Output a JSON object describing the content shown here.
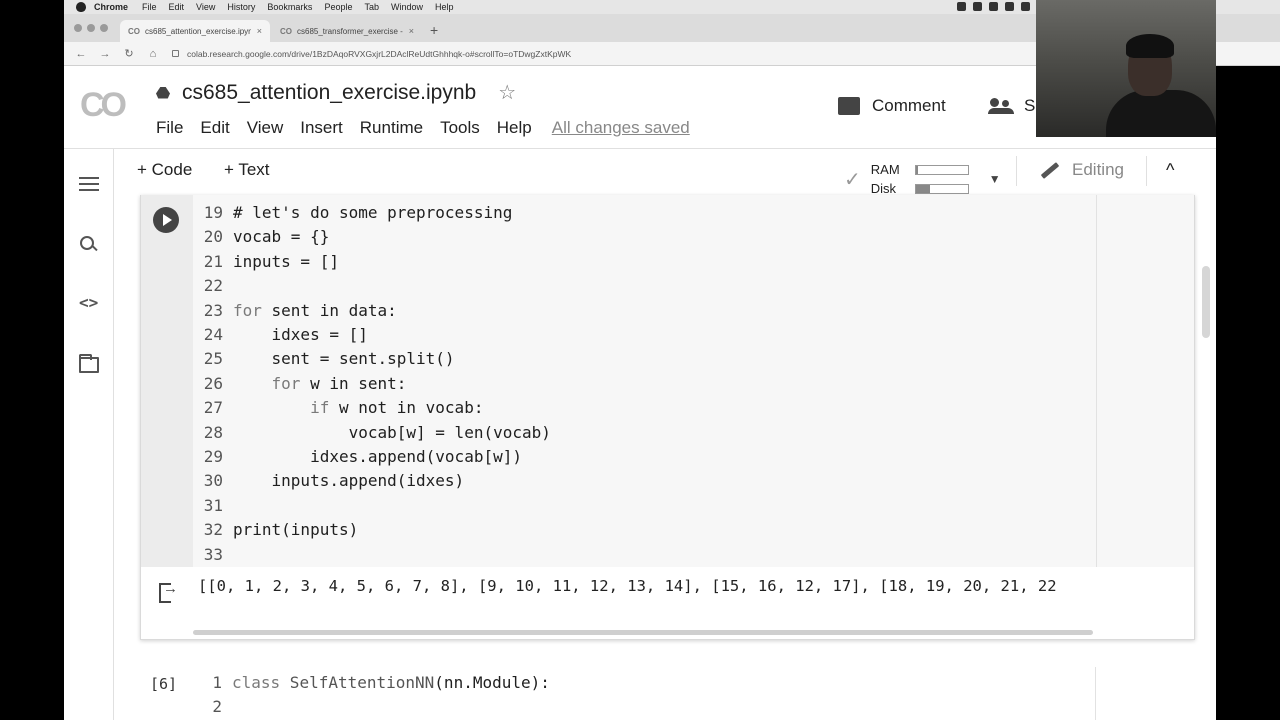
{
  "macos": {
    "app_name": "Chrome",
    "menu": [
      "File",
      "Edit",
      "View",
      "History",
      "Bookmarks",
      "People",
      "Tab",
      "Window",
      "Help"
    ]
  },
  "browser": {
    "tabs": [
      {
        "title": "cs685_attention_exercise.ipyn",
        "favicon": "CO",
        "active": true
      },
      {
        "title": "cs685_transformer_exercise -",
        "favicon": "CO",
        "active": false
      }
    ],
    "new_tab": "+",
    "url": "colab.research.google.com/drive/1BzDAqoRVXGxjrL2DAclReUdtGhhhqk-o#scrollTo=oTDwgZxtKpWK"
  },
  "colab": {
    "logo": "CO",
    "notebook_title": "cs685_attention_exercise.ipynb",
    "menu": [
      "File",
      "Edit",
      "View",
      "Insert",
      "Runtime",
      "Tools",
      "Help"
    ],
    "save_status": "All changes saved",
    "comment_label": "Comment",
    "share_label": "S",
    "add_code": "+ Code",
    "add_text": "+ Text",
    "ram_label": "RAM",
    "disk_label": "Disk",
    "ram_usage": 0.04,
    "disk_usage": 0.28,
    "editing_label": "Editing",
    "collapse_glyph": "^",
    "check_glyph": "✓",
    "dropdown_glyph": "▼"
  },
  "cell1": {
    "line_numbers": [
      "19",
      "20",
      "21",
      "22",
      "23",
      "24",
      "25",
      "26",
      "27",
      "28",
      "29",
      "30",
      "31",
      "32",
      "33"
    ],
    "output": "[[0, 1, 2, 3, 4, 5, 6, 7, 8], [9, 10, 11, 12, 13, 14], [15, 16, 12, 17], [18, 19, 20, 21, 22"
  },
  "cell2": {
    "exec_count": "[6]",
    "line_numbers": [
      "1",
      "2"
    ]
  },
  "code_lines": {
    "l19": "# let's do some preprocessing",
    "l20": "vocab = {}",
    "l21": "inputs = []",
    "l23_kw": "for",
    "l23_rest": " sent in data:",
    "l24": "    idxes = []",
    "l25": "    sent = sent.split()",
    "l26_indent": "    ",
    "l26_kw": "for",
    "l26_rest": " w in sent:",
    "l27_indent": "        ",
    "l27_kw": "if",
    "l27_rest": " w not in vocab:",
    "l28": "            vocab[w] = len(vocab)",
    "l29": "        idxes.append(vocab[w])",
    "l30": "    inputs.append(idxes)",
    "l32": "print(inputs)",
    "c2_l1_kw": "class",
    "c2_l1_name": " SelfAttentionNN",
    "c2_l1_rest": "(nn.Module):"
  }
}
